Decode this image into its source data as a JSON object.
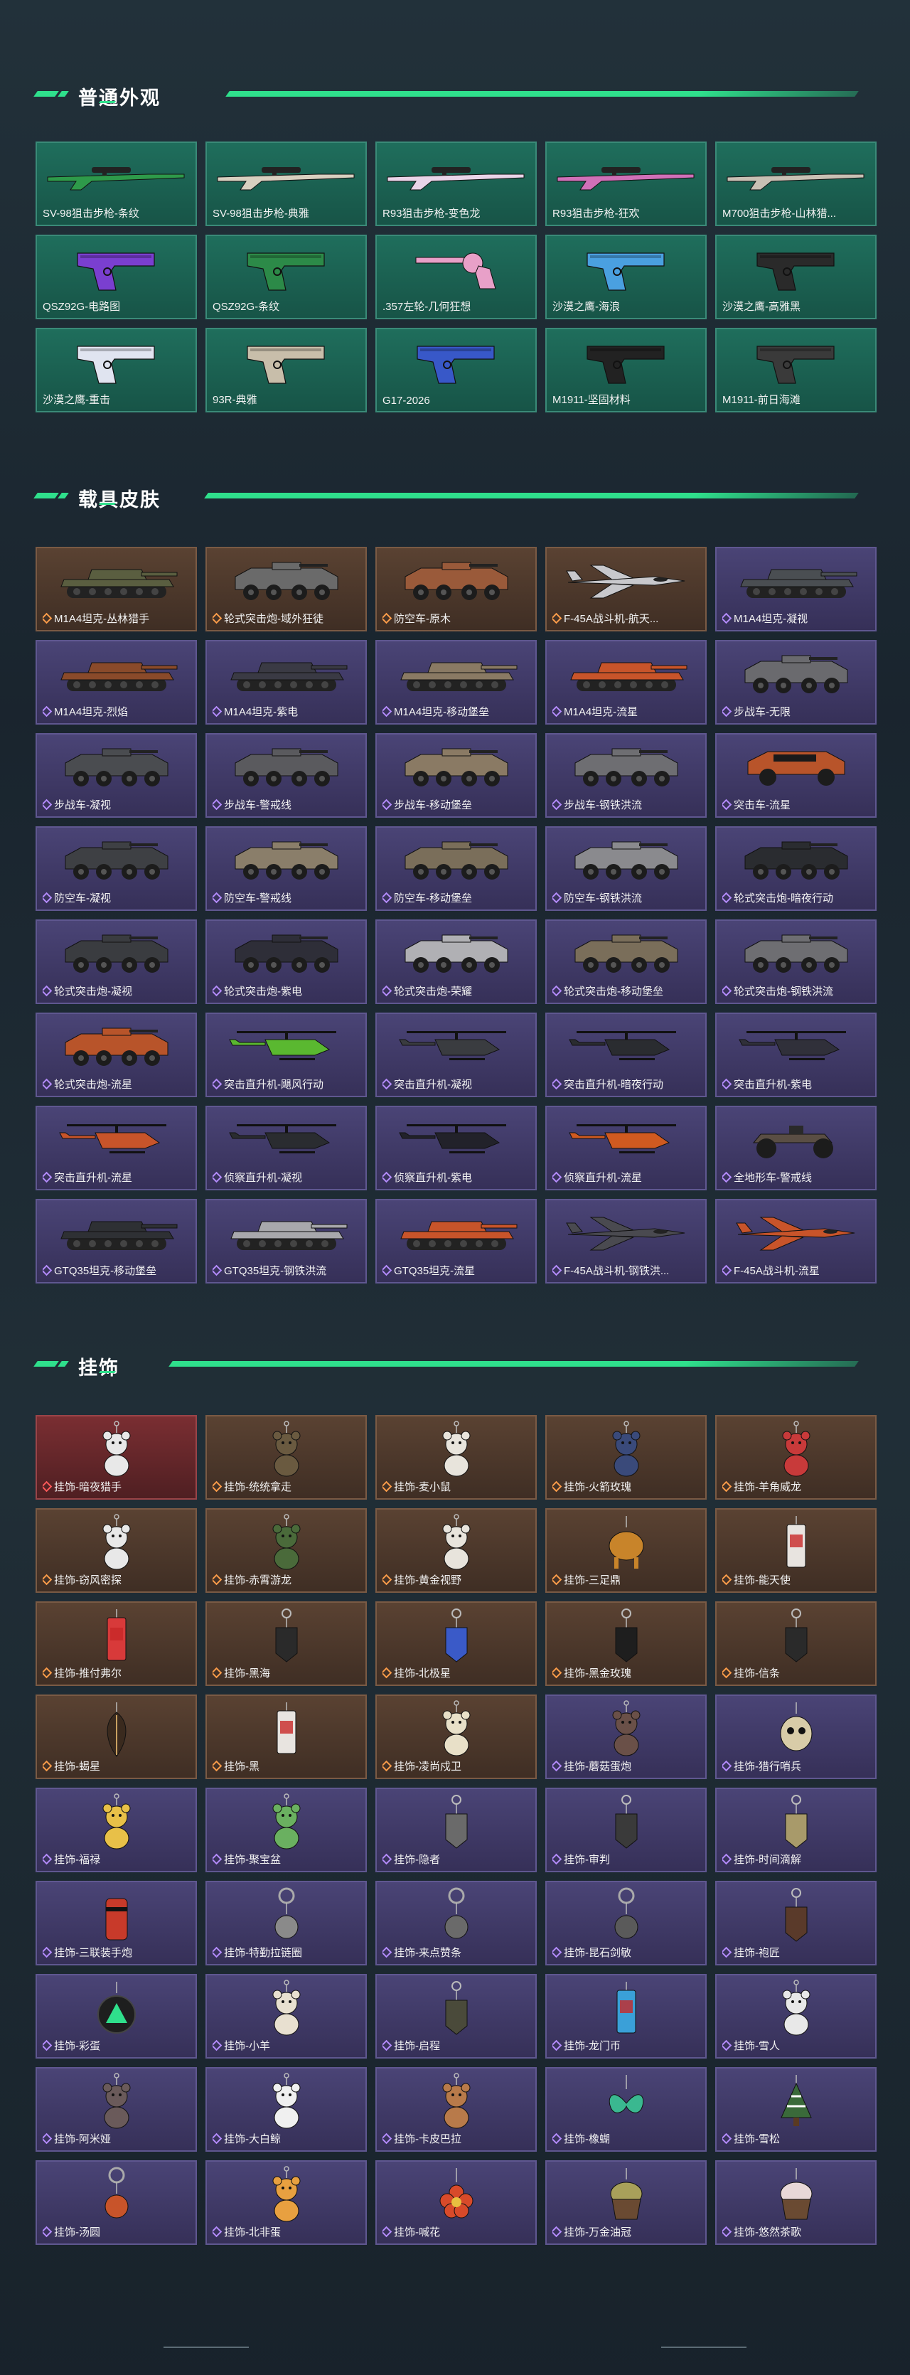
{
  "sections": {
    "weapons": {
      "title": "普通外观"
    },
    "vehicles": {
      "title": "载具皮肤"
    },
    "charms": {
      "title": "挂饰"
    }
  },
  "weapons": [
    {
      "label": "SV-98狙击步枪-条纹",
      "rarity": "none",
      "bg": "green",
      "icon": "sniper-rifle-icon",
      "color": "#2e9a4a"
    },
    {
      "label": "SV-98狙击步枪-典雅",
      "rarity": "none",
      "bg": "green",
      "icon": "sniper-rifle-icon",
      "color": "#d8d0c0"
    },
    {
      "label": "R93狙击步枪-变色龙",
      "rarity": "none",
      "bg": "green",
      "icon": "sniper-rifle-icon",
      "color": "#e9d4e8"
    },
    {
      "label": "R93狙击步枪-狂欢",
      "rarity": "none",
      "bg": "green",
      "icon": "sniper-rifle-icon",
      "color": "#d070b8"
    },
    {
      "label": "M700狙击步枪-山林猎...",
      "rarity": "none",
      "bg": "green",
      "icon": "sniper-rifle-icon",
      "color": "#c8c0b4"
    },
    {
      "label": "QSZ92G-电路图",
      "rarity": "none",
      "bg": "green",
      "icon": "pistol-icon",
      "color": "#7a3fd0"
    },
    {
      "label": "QSZ92G-条纹",
      "rarity": "none",
      "bg": "green",
      "icon": "pistol-icon",
      "color": "#2c8a48"
    },
    {
      "label": ".357左轮-几何狂想",
      "rarity": "none",
      "bg": "green",
      "icon": "revolver-icon",
      "color": "#e8a0c8"
    },
    {
      "label": "沙漠之鹰-海浪",
      "rarity": "none",
      "bg": "green",
      "icon": "pistol-icon",
      "color": "#4aa0e0"
    },
    {
      "label": "沙漠之鹰-高雅黑",
      "rarity": "none",
      "bg": "green",
      "icon": "pistol-icon",
      "color": "#2a2a2a"
    },
    {
      "label": "沙漠之鹰-重击",
      "rarity": "none",
      "bg": "green",
      "icon": "pistol-icon",
      "color": "#e0e4f0"
    },
    {
      "label": "93R-典雅",
      "rarity": "none",
      "bg": "green",
      "icon": "pistol-icon",
      "color": "#c8beaa"
    },
    {
      "label": "G17-2026",
      "rarity": "none",
      "bg": "green",
      "icon": "pistol-icon",
      "color": "#3858c8"
    },
    {
      "label": "M1911-坚固材料",
      "rarity": "none",
      "bg": "green",
      "icon": "pistol-icon",
      "color": "#222222"
    },
    {
      "label": "M1911-前日海滩",
      "rarity": "none",
      "bg": "green",
      "icon": "pistol-icon",
      "color": "#3a3a3a"
    }
  ],
  "vehicles": [
    {
      "label": "M1A4坦克-丛林猎手",
      "rarity": "o",
      "bg": "orange",
      "icon": "tank-icon",
      "color": "#5a5e40"
    },
    {
      "label": "轮式突击炮-域外狂徒",
      "rarity": "o",
      "bg": "orange",
      "icon": "armored-car-icon",
      "color": "#6a6a6a"
    },
    {
      "label": "防空车-原木",
      "rarity": "o",
      "bg": "orange",
      "icon": "armored-car-icon",
      "color": "#9a5a3a"
    },
    {
      "label": "F-45A战斗机-航天...",
      "rarity": "o",
      "bg": "orange",
      "icon": "jet-icon",
      "color": "#c8c8cc"
    },
    {
      "label": "M1A4坦克-凝视",
      "rarity": "p",
      "bg": "purple",
      "icon": "tank-icon",
      "color": "#4a4e52"
    },
    {
      "label": "M1A4坦克-烈焰",
      "rarity": "p",
      "bg": "purple",
      "icon": "tank-icon",
      "color": "#8a4a2a"
    },
    {
      "label": "M1A4坦克-紫电",
      "rarity": "p",
      "bg": "purple",
      "icon": "tank-icon",
      "color": "#3a3a44"
    },
    {
      "label": "M1A4坦克-移动堡垒",
      "rarity": "p",
      "bg": "purple",
      "icon": "tank-icon",
      "color": "#8a7a64"
    },
    {
      "label": "M1A4坦克-流星",
      "rarity": "p",
      "bg": "purple",
      "icon": "tank-icon",
      "color": "#c8542a"
    },
    {
      "label": "步战车-无限",
      "rarity": "p",
      "bg": "purple",
      "icon": "ifv-icon",
      "color": "#6a6a6e"
    },
    {
      "label": "步战车-凝视",
      "rarity": "p",
      "bg": "purple",
      "icon": "ifv-icon",
      "color": "#4a4c50"
    },
    {
      "label": "步战车-警戒线",
      "rarity": "p",
      "bg": "purple",
      "icon": "ifv-icon",
      "color": "#5a5a5e"
    },
    {
      "label": "步战车-移动堡垒",
      "rarity": "p",
      "bg": "purple",
      "icon": "ifv-icon",
      "color": "#8a7a64"
    },
    {
      "label": "步战车-钢铁洪流",
      "rarity": "p",
      "bg": "purple",
      "icon": "ifv-icon",
      "color": "#6e6e72"
    },
    {
      "label": "突击车-流星",
      "rarity": "p",
      "bg": "purple",
      "icon": "assault-vehicle-icon",
      "color": "#b8542a"
    },
    {
      "label": "防空车-凝视",
      "rarity": "p",
      "bg": "purple",
      "icon": "armored-car-icon",
      "color": "#3e4044"
    },
    {
      "label": "防空车-警戒线",
      "rarity": "p",
      "bg": "purple",
      "icon": "armored-car-icon",
      "color": "#8a7e6a"
    },
    {
      "label": "防空车-移动堡垒",
      "rarity": "p",
      "bg": "purple",
      "icon": "armored-car-icon",
      "color": "#7a6e5a"
    },
    {
      "label": "防空车-钢铁洪流",
      "rarity": "p",
      "bg": "purple",
      "icon": "armored-car-icon",
      "color": "#8a8a8e"
    },
    {
      "label": "轮式突击炮-暗夜行动",
      "rarity": "p",
      "bg": "purple",
      "icon": "armored-car-icon",
      "color": "#2a2c30"
    },
    {
      "label": "轮式突击炮-凝视",
      "rarity": "p",
      "bg": "purple",
      "icon": "armored-car-icon",
      "color": "#3a3c40"
    },
    {
      "label": "轮式突击炮-紫电",
      "rarity": "p",
      "bg": "purple",
      "icon": "armored-car-icon",
      "color": "#2e2e38"
    },
    {
      "label": "轮式突击炮-荣耀",
      "rarity": "p",
      "bg": "purple",
      "icon": "armored-car-icon",
      "color": "#b0b0b4"
    },
    {
      "label": "轮式突击炮-移动堡垒",
      "rarity": "p",
      "bg": "purple",
      "icon": "armored-car-icon",
      "color": "#7a6e5a"
    },
    {
      "label": "轮式突击炮-钢铁洪流",
      "rarity": "p",
      "bg": "purple",
      "icon": "armored-car-icon",
      "color": "#6e6e72"
    },
    {
      "label": "轮式突击炮-流星",
      "rarity": "p",
      "bg": "purple",
      "icon": "armored-car-icon",
      "color": "#b8542a"
    },
    {
      "label": "突击直升机-飓风行动",
      "rarity": "p",
      "bg": "purple",
      "icon": "helicopter-icon",
      "color": "#5ab830"
    },
    {
      "label": "突击直升机-凝视",
      "rarity": "p",
      "bg": "purple",
      "icon": "helicopter-icon",
      "color": "#3a3c40"
    },
    {
      "label": "突击直升机-暗夜行动",
      "rarity": "p",
      "bg": "purple",
      "icon": "helicopter-icon",
      "color": "#2a2c30"
    },
    {
      "label": "突击直升机-紫电",
      "rarity": "p",
      "bg": "purple",
      "icon": "helicopter-icon",
      "color": "#30303a"
    },
    {
      "label": "突击直升机-流星",
      "rarity": "p",
      "bg": "purple",
      "icon": "helicopter-icon",
      "color": "#c8542a"
    },
    {
      "label": "侦察直升机-凝视",
      "rarity": "p",
      "bg": "purple",
      "icon": "helicopter-icon",
      "color": "#2a2c30"
    },
    {
      "label": "侦察直升机-紫电",
      "rarity": "p",
      "bg": "purple",
      "icon": "helicopter-icon",
      "color": "#22222a"
    },
    {
      "label": "侦察直升机-流星",
      "rarity": "p",
      "bg": "purple",
      "icon": "helicopter-icon",
      "color": "#d05a20"
    },
    {
      "label": "全地形车-警戒线",
      "rarity": "p",
      "bg": "purple",
      "icon": "atv-icon",
      "color": "#5a4e44"
    },
    {
      "label": "GTQ35坦克-移动堡垒",
      "rarity": "p",
      "bg": "purple",
      "icon": "tank-icon",
      "color": "#2e3034"
    },
    {
      "label": "GTQ35坦克-钢铁洪流",
      "rarity": "p",
      "bg": "purple",
      "icon": "tank-icon",
      "color": "#a8a8ac"
    },
    {
      "label": "GTQ35坦克-流星",
      "rarity": "p",
      "bg": "purple",
      "icon": "tank-icon",
      "color": "#c8542a"
    },
    {
      "label": "F-45A战斗机-钢铁洪...",
      "rarity": "p",
      "bg": "purple",
      "icon": "jet-icon",
      "color": "#4a4a50"
    },
    {
      "label": "F-45A战斗机-流星",
      "rarity": "p",
      "bg": "purple",
      "icon": "jet-icon",
      "color": "#c8542a"
    }
  ],
  "charms": [
    {
      "label": "挂饰-暗夜猎手",
      "rarity": "r",
      "bg": "red",
      "icon": "bear-charm-icon",
      "color": "#e8e8e8"
    },
    {
      "label": "挂饰-统统拿走",
      "rarity": "o",
      "bg": "orange",
      "icon": "figure-charm-icon",
      "color": "#6a5a40"
    },
    {
      "label": "挂饰-麦小鼠",
      "rarity": "o",
      "bg": "orange",
      "icon": "mouse-charm-icon",
      "color": "#e8e4dc"
    },
    {
      "label": "挂饰-火箭玫瑰",
      "rarity": "o",
      "bg": "orange",
      "icon": "figure-charm-icon",
      "color": "#3a4a7a"
    },
    {
      "label": "挂饰-羊角威龙",
      "rarity": "o",
      "bg": "orange",
      "icon": "figure-charm-icon",
      "color": "#c83a3a"
    },
    {
      "label": "挂饰-窃风密探",
      "rarity": "o",
      "bg": "orange",
      "icon": "figure-charm-icon",
      "color": "#e8e8e8"
    },
    {
      "label": "挂饰-赤霄游龙",
      "rarity": "o",
      "bg": "orange",
      "icon": "figure-charm-icon",
      "color": "#4a6a3a"
    },
    {
      "label": "挂饰-黄金视野",
      "rarity": "o",
      "bg": "orange",
      "icon": "figure-charm-icon",
      "color": "#e8e4dc"
    },
    {
      "label": "挂饰-三足鼎",
      "rarity": "o",
      "bg": "orange",
      "icon": "tripod-charm-icon",
      "color": "#c8842a"
    },
    {
      "label": "挂饰-能天使",
      "rarity": "o",
      "bg": "orange",
      "icon": "card-charm-icon",
      "color": "#e8e4e0"
    },
    {
      "label": "挂饰-推付弗尔",
      "rarity": "o",
      "bg": "orange",
      "icon": "card-charm-icon",
      "color": "#d83a3a"
    },
    {
      "label": "挂饰-黑海",
      "rarity": "o",
      "bg": "orange",
      "icon": "tag-charm-icon",
      "color": "#2a2a2a"
    },
    {
      "label": "挂饰-北极星",
      "rarity": "o",
      "bg": "orange",
      "icon": "tag-charm-icon",
      "color": "#3a5ac8"
    },
    {
      "label": "挂饰-黑金玫瑰",
      "rarity": "o",
      "bg": "orange",
      "icon": "tag-charm-icon",
      "color": "#1e1e1e"
    },
    {
      "label": "挂饰-信条",
      "rarity": "o",
      "bg": "orange",
      "icon": "tag-charm-icon",
      "color": "#2a2a2a"
    },
    {
      "label": "挂饰-蝎星",
      "rarity": "o",
      "bg": "orange",
      "icon": "feather-charm-icon",
      "color": "#3a2a1e"
    },
    {
      "label": "挂饰-黑",
      "rarity": "o",
      "bg": "orange",
      "icon": "card-charm-icon",
      "color": "#e8e4e0"
    },
    {
      "label": "挂饰-凌尚戍卫",
      "rarity": "o",
      "bg": "orange",
      "icon": "figure-charm-icon",
      "color": "#e8e0c8"
    },
    {
      "label": "挂饰-蘑菇蛋炮",
      "rarity": "p",
      "bg": "purple",
      "icon": "figure-charm-icon",
      "color": "#6a5048"
    },
    {
      "label": "挂饰-猎行哨兵",
      "rarity": "p",
      "bg": "purple",
      "icon": "skull-charm-icon",
      "color": "#d8cca8"
    },
    {
      "label": "挂饰-福禄",
      "rarity": "p",
      "bg": "purple",
      "icon": "figure-charm-icon",
      "color": "#e8c048"
    },
    {
      "label": "挂饰-聚宝盆",
      "rarity": "p",
      "bg": "purple",
      "icon": "figure-charm-icon",
      "color": "#6ab060"
    },
    {
      "label": "挂饰-隐者",
      "rarity": "p",
      "bg": "purple",
      "icon": "tag-charm-icon",
      "color": "#6a6a6a"
    },
    {
      "label": "挂饰-审判",
      "rarity": "p",
      "bg": "purple",
      "icon": "tag-charm-icon",
      "color": "#3a3a3a"
    },
    {
      "label": "挂饰-时间滴解",
      "rarity": "p",
      "bg": "purple",
      "icon": "tag-charm-icon",
      "color": "#a89a6a"
    },
    {
      "label": "挂饰-三联装手炮",
      "rarity": "p",
      "bg": "purple",
      "icon": "cylinder-charm-icon",
      "color": "#c83a2a"
    },
    {
      "label": "挂饰-特勤拉链圈",
      "rarity": "p",
      "bg": "purple",
      "icon": "ring-charm-icon",
      "color": "#8a8a8a"
    },
    {
      "label": "挂饰-来点赞条",
      "rarity": "p",
      "bg": "purple",
      "icon": "ring-charm-icon",
      "color": "#6a6a6a"
    },
    {
      "label": "挂饰-昆石剑敏",
      "rarity": "p",
      "bg": "purple",
      "icon": "ring-charm-icon",
      "color": "#5a5a5a"
    },
    {
      "label": "挂饰-袍匠",
      "rarity": "p",
      "bg": "purple",
      "icon": "tag-charm-icon",
      "color": "#5a3a2a"
    },
    {
      "label": "挂饰-彩蛋",
      "rarity": "p",
      "bg": "purple",
      "icon": "triangle-charm-icon",
      "color": "#2fe08c"
    },
    {
      "label": "挂饰-小羊",
      "rarity": "p",
      "bg": "purple",
      "icon": "figure-charm-icon",
      "color": "#e8e0d0"
    },
    {
      "label": "挂饰-启程",
      "rarity": "p",
      "bg": "purple",
      "icon": "tag-charm-icon",
      "color": "#4a4a3a"
    },
    {
      "label": "挂饰-龙门币",
      "rarity": "p",
      "bg": "purple",
      "icon": "card-charm-icon",
      "color": "#3aa0d8"
    },
    {
      "label": "挂饰-雪人",
      "rarity": "p",
      "bg": "purple",
      "icon": "figure-charm-icon",
      "color": "#e8e8e8"
    },
    {
      "label": "挂饰-阿米娅",
      "rarity": "p",
      "bg": "purple",
      "icon": "figure-charm-icon",
      "color": "#6a5a5a"
    },
    {
      "label": "挂饰-大白鲸",
      "rarity": "p",
      "bg": "purple",
      "icon": "figure-charm-icon",
      "color": "#f0f0f0"
    },
    {
      "label": "挂饰-卡皮巴拉",
      "rarity": "p",
      "bg": "purple",
      "icon": "figure-charm-icon",
      "color": "#b87a4a"
    },
    {
      "label": "挂饰-橡蝴",
      "rarity": "p",
      "bg": "purple",
      "icon": "butterfly-charm-icon",
      "color": "#3ab890"
    },
    {
      "label": "挂饰-雪松",
      "rarity": "p",
      "bg": "purple",
      "icon": "tree-charm-icon",
      "color": "#3a6a3a"
    },
    {
      "label": "挂饰-汤圆",
      "rarity": "p",
      "bg": "purple",
      "icon": "ring-charm-icon",
      "color": "#c8542a"
    },
    {
      "label": "挂饰-北非蛋",
      "rarity": "p",
      "bg": "purple",
      "icon": "figure-charm-icon",
      "color": "#e8a040"
    },
    {
      "label": "挂饰-喊花",
      "rarity": "p",
      "bg": "purple",
      "icon": "flower-charm-icon",
      "color": "#d84a2a"
    },
    {
      "label": "挂饰-万金油冠",
      "rarity": "p",
      "bg": "purple",
      "icon": "cake-charm-icon",
      "color": "#a8a05a"
    },
    {
      "label": "挂饰-悠然茶歌",
      "rarity": "p",
      "bg": "purple",
      "icon": "cake-charm-icon",
      "color": "#e8d8d8"
    }
  ]
}
